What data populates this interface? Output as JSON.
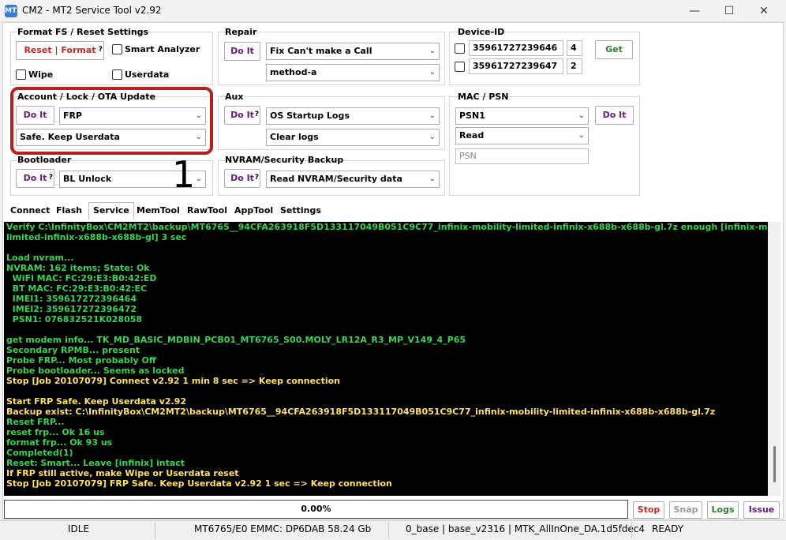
{
  "window": {
    "title": "CM2 - MT2 Service Tool v2.92",
    "icon_label": "MT2",
    "controls": {
      "minimize": "—",
      "maximize": "☐",
      "close": "✕"
    }
  },
  "format_fs": {
    "title": "Format FS / Reset Settings",
    "reset_format_btn": "Reset | Format",
    "q": "?",
    "smart_analyzer": "Smart Analyzer",
    "wipe": "Wipe",
    "userdata": "Userdata"
  },
  "repair": {
    "title": "Repair",
    "do_it": "Do It",
    "select1": "Fix Can't make a Call",
    "select2": "method-a"
  },
  "device_id": {
    "title": "Device-ID",
    "imei1": "35961727239646",
    "n1": "4",
    "imei2": "35961727239647",
    "n2": "2",
    "get_btn": "Get"
  },
  "account": {
    "title": "Account / Lock / OTA Update",
    "do_it": "Do It",
    "select1": "FRP",
    "select2": "Safe. Keep Userdata"
  },
  "aux": {
    "title": "Aux",
    "do_it": "Do It",
    "q": "?",
    "select1": "OS Startup Logs",
    "select2": "Clear logs"
  },
  "mac_psn": {
    "title": "MAC / PSN",
    "select1": "PSN1",
    "select2": "Read",
    "psn_placeholder": "PSN",
    "do_it": "Do It"
  },
  "bootloader": {
    "title": "Bootloader",
    "do_it": "Do It",
    "q": "?",
    "select1": "BL Unlock"
  },
  "nvram": {
    "title": "NVRAM/Security Backup",
    "do_it": "Do It",
    "q": "?",
    "select1": "Read NVRAM/Security data"
  },
  "annotation": {
    "number": "1"
  },
  "tabs": [
    "Connect",
    "Flash",
    "Service",
    "MemTool",
    "RawTool",
    "AppTool",
    "Settings"
  ],
  "log_lines": [
    {
      "t": "Verify C:\\InfinityBox\\CM2MT2\\backup\\MT6765__94CFA263918F5D133117049B051C9C77_infinix-mobility-limited-infinix-x688b-x688b-gl.7z enough [infinix-mobility-",
      "c": "green"
    },
    {
      "t": "limited-infinix-x688b-x688b-gl] 3 sec",
      "c": "green"
    },
    {
      "t": "",
      "c": "blank"
    },
    {
      "t": "Load nvram...",
      "c": "green"
    },
    {
      "t": "NVRAM: 162 items; State: Ok",
      "c": "green"
    },
    {
      "t": "  WiFi MAC: FC:29:E3:B0:42:ED",
      "c": "green"
    },
    {
      "t": "  BT MAC: FC:29:E3:B0:42:EC",
      "c": "green"
    },
    {
      "t": "  IMEI1: 359617272396464",
      "c": "green"
    },
    {
      "t": "  IMEI2: 359617272396472",
      "c": "green"
    },
    {
      "t": "  PSN1: 076832521K028058",
      "c": "green"
    },
    {
      "t": "",
      "c": "blank"
    },
    {
      "t": "get modem info... TK_MD_BASIC_MDBIN_PCB01_MT6765_S00.MOLY_LR12A_R3_MP_V149_4_P65",
      "c": "green"
    },
    {
      "t": "Secondary RPMB... present",
      "c": "green"
    },
    {
      "t": "Probe FRP... Most probably Off",
      "c": "green"
    },
    {
      "t": "Probe bootloader... Seems as locked",
      "c": "green"
    },
    {
      "t": "Stop [Job 20107079] Connect v2.92 1 min 8 sec => Keep connection",
      "c": "yellow"
    },
    {
      "t": "",
      "c": "blank"
    },
    {
      "t": "Start FRP Safe. Keep Userdata v2.92",
      "c": "yellow"
    },
    {
      "t": "Backup exist: C:\\InfinityBox\\CM2MT2\\backup\\MT6765__94CFA263918F5D133117049B051C9C77_infinix-mobility-limited-infinix-x688b-x688b-gl.7z",
      "c": "yellow"
    },
    {
      "t": "Reset FRP...",
      "c": "green"
    },
    {
      "t": "reset frp... Ok 16 us",
      "c": "green"
    },
    {
      "t": "format frp... Ok 93 us",
      "c": "green"
    },
    {
      "t": "Completed(1)",
      "c": "green"
    },
    {
      "t": "Reset: Smart... Leave [infinix] intact",
      "c": "green"
    },
    {
      "t": "If FRP still active, make Wipe or Userdata reset",
      "c": "yellow"
    },
    {
      "t": "Stop [Job 20107079] FRP Safe. Keep Userdata v2.92 1 sec => Keep connection",
      "c": "yellow"
    }
  ],
  "progress": {
    "value": 0,
    "label": "0.00%"
  },
  "bottom_buttons": {
    "stop": "Stop",
    "snap": "Snap",
    "logs": "Logs",
    "issue": "Issue"
  },
  "status": {
    "state": "IDLE",
    "chip": "MT6765/E0 EMMC: DP6DAB 58.24 Gb",
    "base": "0_base | base_v2316 | MTK_AllInOne_DA.1d5fdec4",
    "ready": "READY"
  },
  "colors": {
    "log_green": "#39d353",
    "log_yellow": "#ffe066",
    "highlight": "#b3201e",
    "do_it_text": "#6a1b7a"
  }
}
